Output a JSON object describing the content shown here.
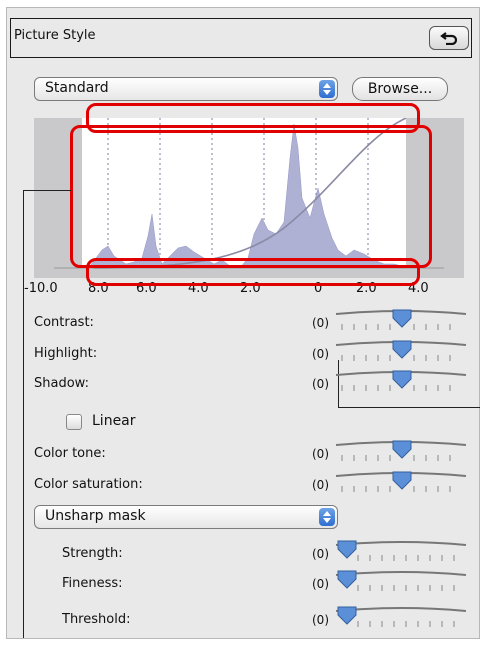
{
  "panel": {
    "title": "Picture Style"
  },
  "style_select": {
    "value": "Standard"
  },
  "browse_button": {
    "label": "Browse..."
  },
  "histogram": {
    "ticks": [
      "-10.0",
      "8.0",
      "6.0",
      "4.0",
      "2.0",
      "0",
      "2.0",
      "4.0"
    ]
  },
  "adjustments": [
    {
      "label": "Contrast:",
      "value": "(0)",
      "level": 0.5
    },
    {
      "label": "Highlight:",
      "value": "(0)",
      "level": 0.5
    },
    {
      "label": "Shadow:",
      "value": "(0)",
      "level": 0.5
    }
  ],
  "linear": {
    "label": "Linear",
    "checked": false
  },
  "color": [
    {
      "label": "Color tone:",
      "value": "(0)",
      "level": 0.5
    },
    {
      "label": "Color saturation:",
      "value": "(0)",
      "level": 0.5
    }
  ],
  "sharp_select": {
    "value": "Unsharp mask"
  },
  "sharpness": [
    {
      "label": "Strength:",
      "value": "(0)",
      "level": 0
    },
    {
      "label": "Fineness:",
      "value": "(0)",
      "level": 0
    },
    {
      "label": "Threshold:",
      "value": "(0)",
      "level": 0
    }
  ],
  "colors": {
    "highlight": "#e10000",
    "histogram_fill": "#aeb0d4",
    "thumb": "#5b8fd8"
  }
}
